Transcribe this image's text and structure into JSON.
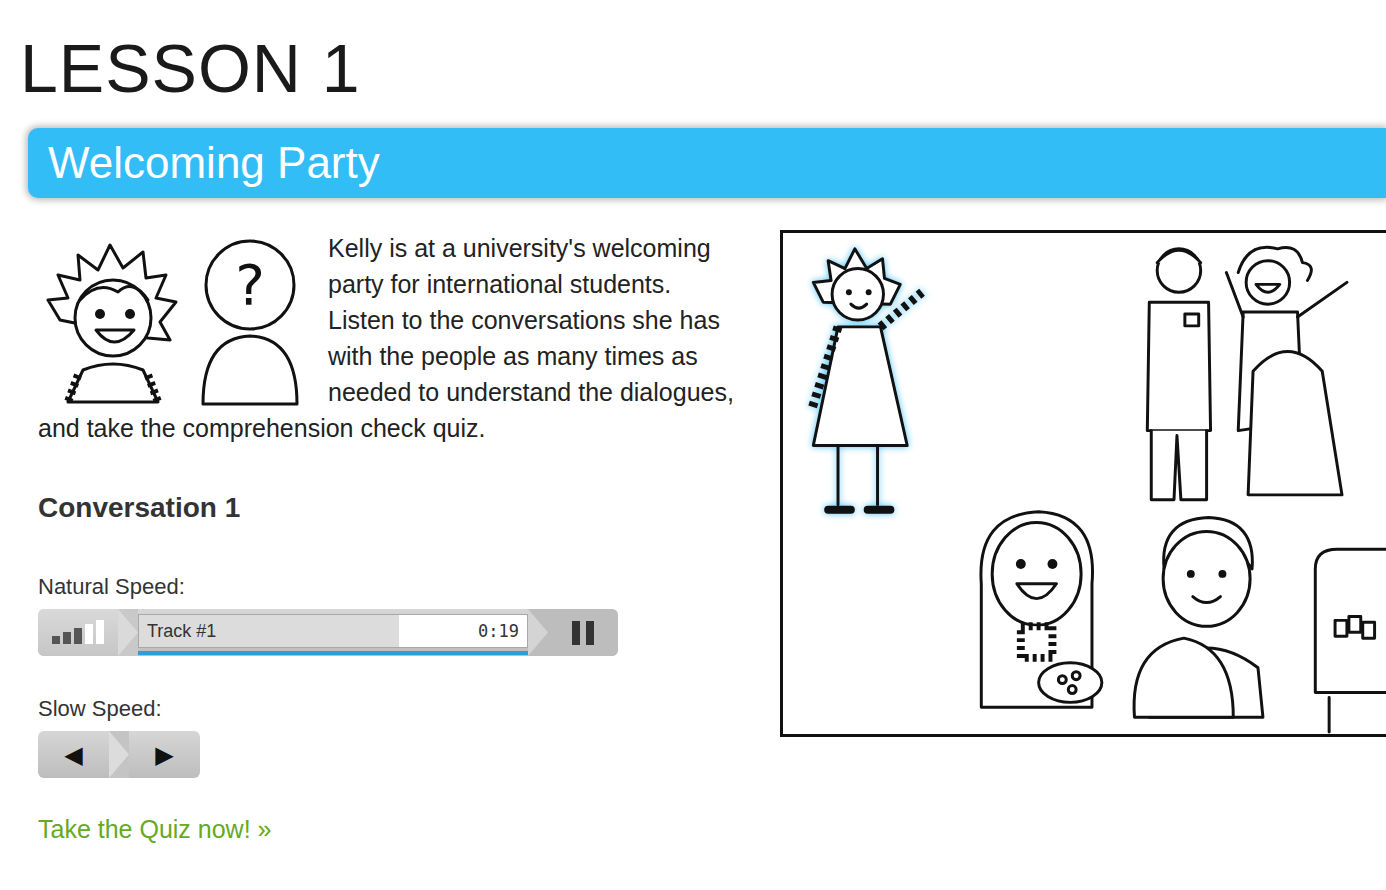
{
  "lesson": {
    "title": "LESSON 1"
  },
  "banner": {
    "title": "Welcoming Party"
  },
  "intro": {
    "text": "Kelly is at a university's welcoming party for international students. Listen to the conversations she has with the people as many times as needed to understand the dialogues, and take the comprehension check quiz.",
    "unknown_person_mark": "?"
  },
  "conversation": {
    "title": "Conversation 1"
  },
  "natural_player": {
    "label": "Natural Speed:",
    "track": "Track #1",
    "time": "0:19",
    "volume": 0.6,
    "progress": 0.67,
    "loaded": 1,
    "playing": true
  },
  "slow_player": {
    "label": "Slow Speed:",
    "buttons": [
      "◀",
      "▶"
    ]
  },
  "quiz_link": {
    "text": "Take the Quiz now! »"
  }
}
